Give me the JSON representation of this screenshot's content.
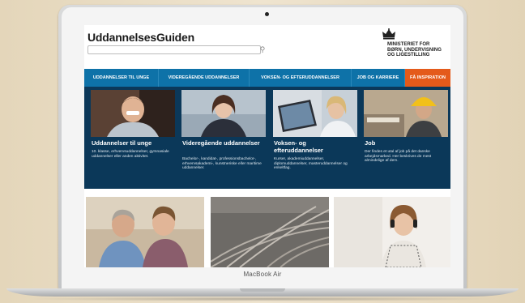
{
  "device": {
    "brand_label": "MacBook Air"
  },
  "site": {
    "logo_text": "UddannelsesGuiden",
    "search": {
      "placeholder": ""
    },
    "ministry": {
      "lines": [
        "MINISTERIET FOR",
        "BØRN, UNDERVISNING",
        "OG LIGESTILLING"
      ]
    }
  },
  "nav": {
    "items": [
      {
        "label": "UDDANNELSER TIL UNGE"
      },
      {
        "label": "VIDEREGÅENDE UDDANNELSER"
      },
      {
        "label": "VOKSEN- OG EFTERUDDANNELSER"
      },
      {
        "label": "JOB OG KARRIERE"
      },
      {
        "label": "FÅ INSPIRATION"
      }
    ],
    "active_index": 4
  },
  "cards": [
    {
      "title": "Uddannelser til unge",
      "description": "10. klasse, erhvervsuddannelser, gymnasiale uddannelser eller anden aktivitet."
    },
    {
      "title": "Videregående uddannelser",
      "description": "Bachelor-, kandidat-, professionsbachelor-, erhvervsakademi-, kunstneriske eller maritime uddannelser."
    },
    {
      "title": "Voksen- og efteruddannelser",
      "description": "Kurser, akademiuddannelser, diplomuddannelser, masteruddannelser og enkeltfag."
    },
    {
      "title": "Job",
      "description": "Der findes et utal af job på det danske arbejdsmarked. Her beskrives de mest almindelige af dem."
    }
  ],
  "colors": {
    "nav_blue": "#0e72a8",
    "nav_active_orange": "#e45a1b",
    "panel_navy": "#0b3859"
  }
}
